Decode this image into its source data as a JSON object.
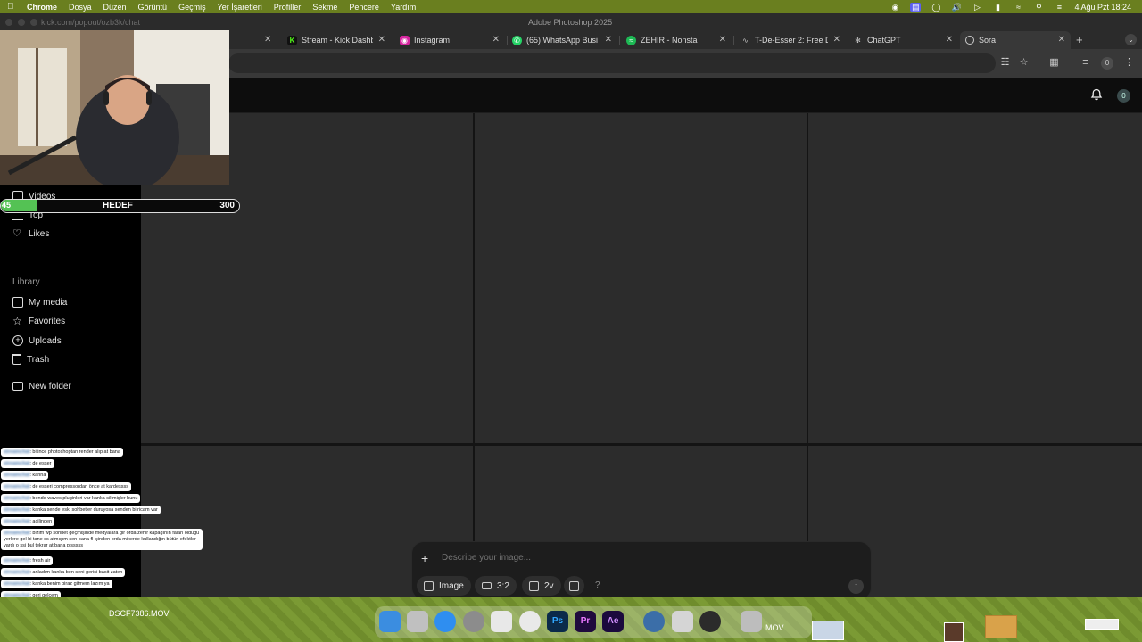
{
  "menubar": {
    "app": "Chrome",
    "items": [
      "Dosya",
      "Düzen",
      "Görüntü",
      "Geçmiş",
      "Yer İşaretleri",
      "Profiller",
      "Sekme",
      "Pencere",
      "Yardım"
    ],
    "clock": "4 Ağu Pzt  18:24"
  },
  "window": {
    "title": "Adobe Photoshop 2025",
    "url_fragment": "kick.com/popout/ozb3k/chat"
  },
  "tabs": [
    {
      "label": "Stream - Kick Dashb",
      "icon": "kick-icon",
      "color": "#53fc18"
    },
    {
      "label": "Instagram",
      "icon": "instagram-icon",
      "color": "#d6249f"
    },
    {
      "label": "(65) WhatsApp Busi",
      "icon": "whatsapp-icon",
      "color": "#25d366"
    },
    {
      "label": "ZEHIR - Nonsta",
      "icon": "spotify-icon",
      "color": "#1db954"
    },
    {
      "label": "T-De-Esser 2: Free D",
      "icon": "tb-icon",
      "color": "#777777"
    },
    {
      "label": "ChatGPT",
      "icon": "chatgpt-icon",
      "color": "#888888"
    },
    {
      "label": "Sora",
      "icon": "sora-icon",
      "color": "#888888",
      "active": true
    }
  ],
  "toolbar": {
    "profile_count": "0"
  },
  "header": {
    "notification_count": "0"
  },
  "sidebar": {
    "items_top": [
      {
        "label": "Videos",
        "icon": "video-icon"
      },
      {
        "label": "Top",
        "icon": "top-icon"
      },
      {
        "label": "Likes",
        "icon": "heart-icon"
      }
    ],
    "library_label": "Library",
    "library_items": [
      {
        "label": "My media",
        "icon": "media-icon"
      },
      {
        "label": "Favorites",
        "icon": "star-icon"
      },
      {
        "label": "Uploads",
        "icon": "upload-icon"
      },
      {
        "label": "Trash",
        "icon": "trash-icon"
      }
    ],
    "new_folder": "New folder"
  },
  "composer": {
    "placeholder": "Describe your image...",
    "type_label": "Image",
    "aspect_label": "3:2",
    "variations_label": "2v",
    "help_label": "?"
  },
  "goal": {
    "current": "45",
    "label": "HEDEF",
    "target": "300",
    "progress": 0.15
  },
  "chat": [
    {
      "user": "streamchat",
      "text": ": bitince photoshoptan render alıp at bana"
    },
    {
      "user": "streamchat",
      "text": ": de esser"
    },
    {
      "user": "streamchat",
      "text": ": kanna"
    },
    {
      "user": "streamchat",
      "text": ": de esseri compressordan önce at kardessss"
    },
    {
      "user": "streamchat",
      "text": ": bende waves pluginleri var kanka sikmişler bunu"
    },
    {
      "user": "streamchat",
      "text": ": kanka sende eski sohbetler duruyosa senden bi ricam var"
    },
    {
      "user": "streamchat",
      "text": ": acilinden"
    },
    {
      "user": "streamchat",
      "text": ": bizim wp sohbet geçmişinde medyalara gir orda zehir kapağının falan olduğu yerlere gel bi tane ss atmışım sen bana fl içinden orda mixerde kullandığın bütün efektler vardı o ssi bul tekrar at bana plsssss"
    },
    {
      "user": "streamchat",
      "text": ": fresh air"
    },
    {
      "user": "streamchat",
      "text": ": anladım kanka ben seni gerisi basit zaten"
    },
    {
      "user": "streamchat",
      "text": ": kanka benim biraz gitmem lazım ya"
    },
    {
      "user": "streamchat",
      "text": ": geri gelcem"
    }
  ],
  "desktop": {
    "file_left": "DSCF7386.MOV",
    "file_mid": "MOV"
  },
  "dock": [
    {
      "name": "finder-icon",
      "label": "",
      "color": "#3b8de0"
    },
    {
      "name": "launchpad-icon",
      "label": "",
      "color": "#c0c0c0"
    },
    {
      "name": "safari-icon",
      "label": "",
      "color": "#2f8ef0"
    },
    {
      "name": "settings-icon",
      "label": "",
      "color": "#8c8c8c"
    },
    {
      "name": "notes-icon",
      "label": "",
      "color": "#e8e8e8"
    },
    {
      "name": "chrome-icon",
      "label": "",
      "color": "#e9e9e9"
    },
    {
      "name": "photoshop-icon",
      "label": "Ps",
      "color": "#0b2a4a"
    },
    {
      "name": "premiere-icon",
      "label": "Pr",
      "color": "#1f0a3d"
    },
    {
      "name": "aftereffects-icon",
      "label": "Ae",
      "color": "#1b0a3d"
    },
    {
      "name": "quicktime-icon",
      "label": "",
      "color": "#3b6ea8"
    },
    {
      "name": "preview-icon",
      "label": "",
      "color": "#d5d5d5"
    },
    {
      "name": "obs-icon",
      "label": "",
      "color": "#2b2b2b"
    },
    {
      "name": "trash-dock-icon",
      "label": "",
      "color": "#bdbdbd"
    }
  ]
}
